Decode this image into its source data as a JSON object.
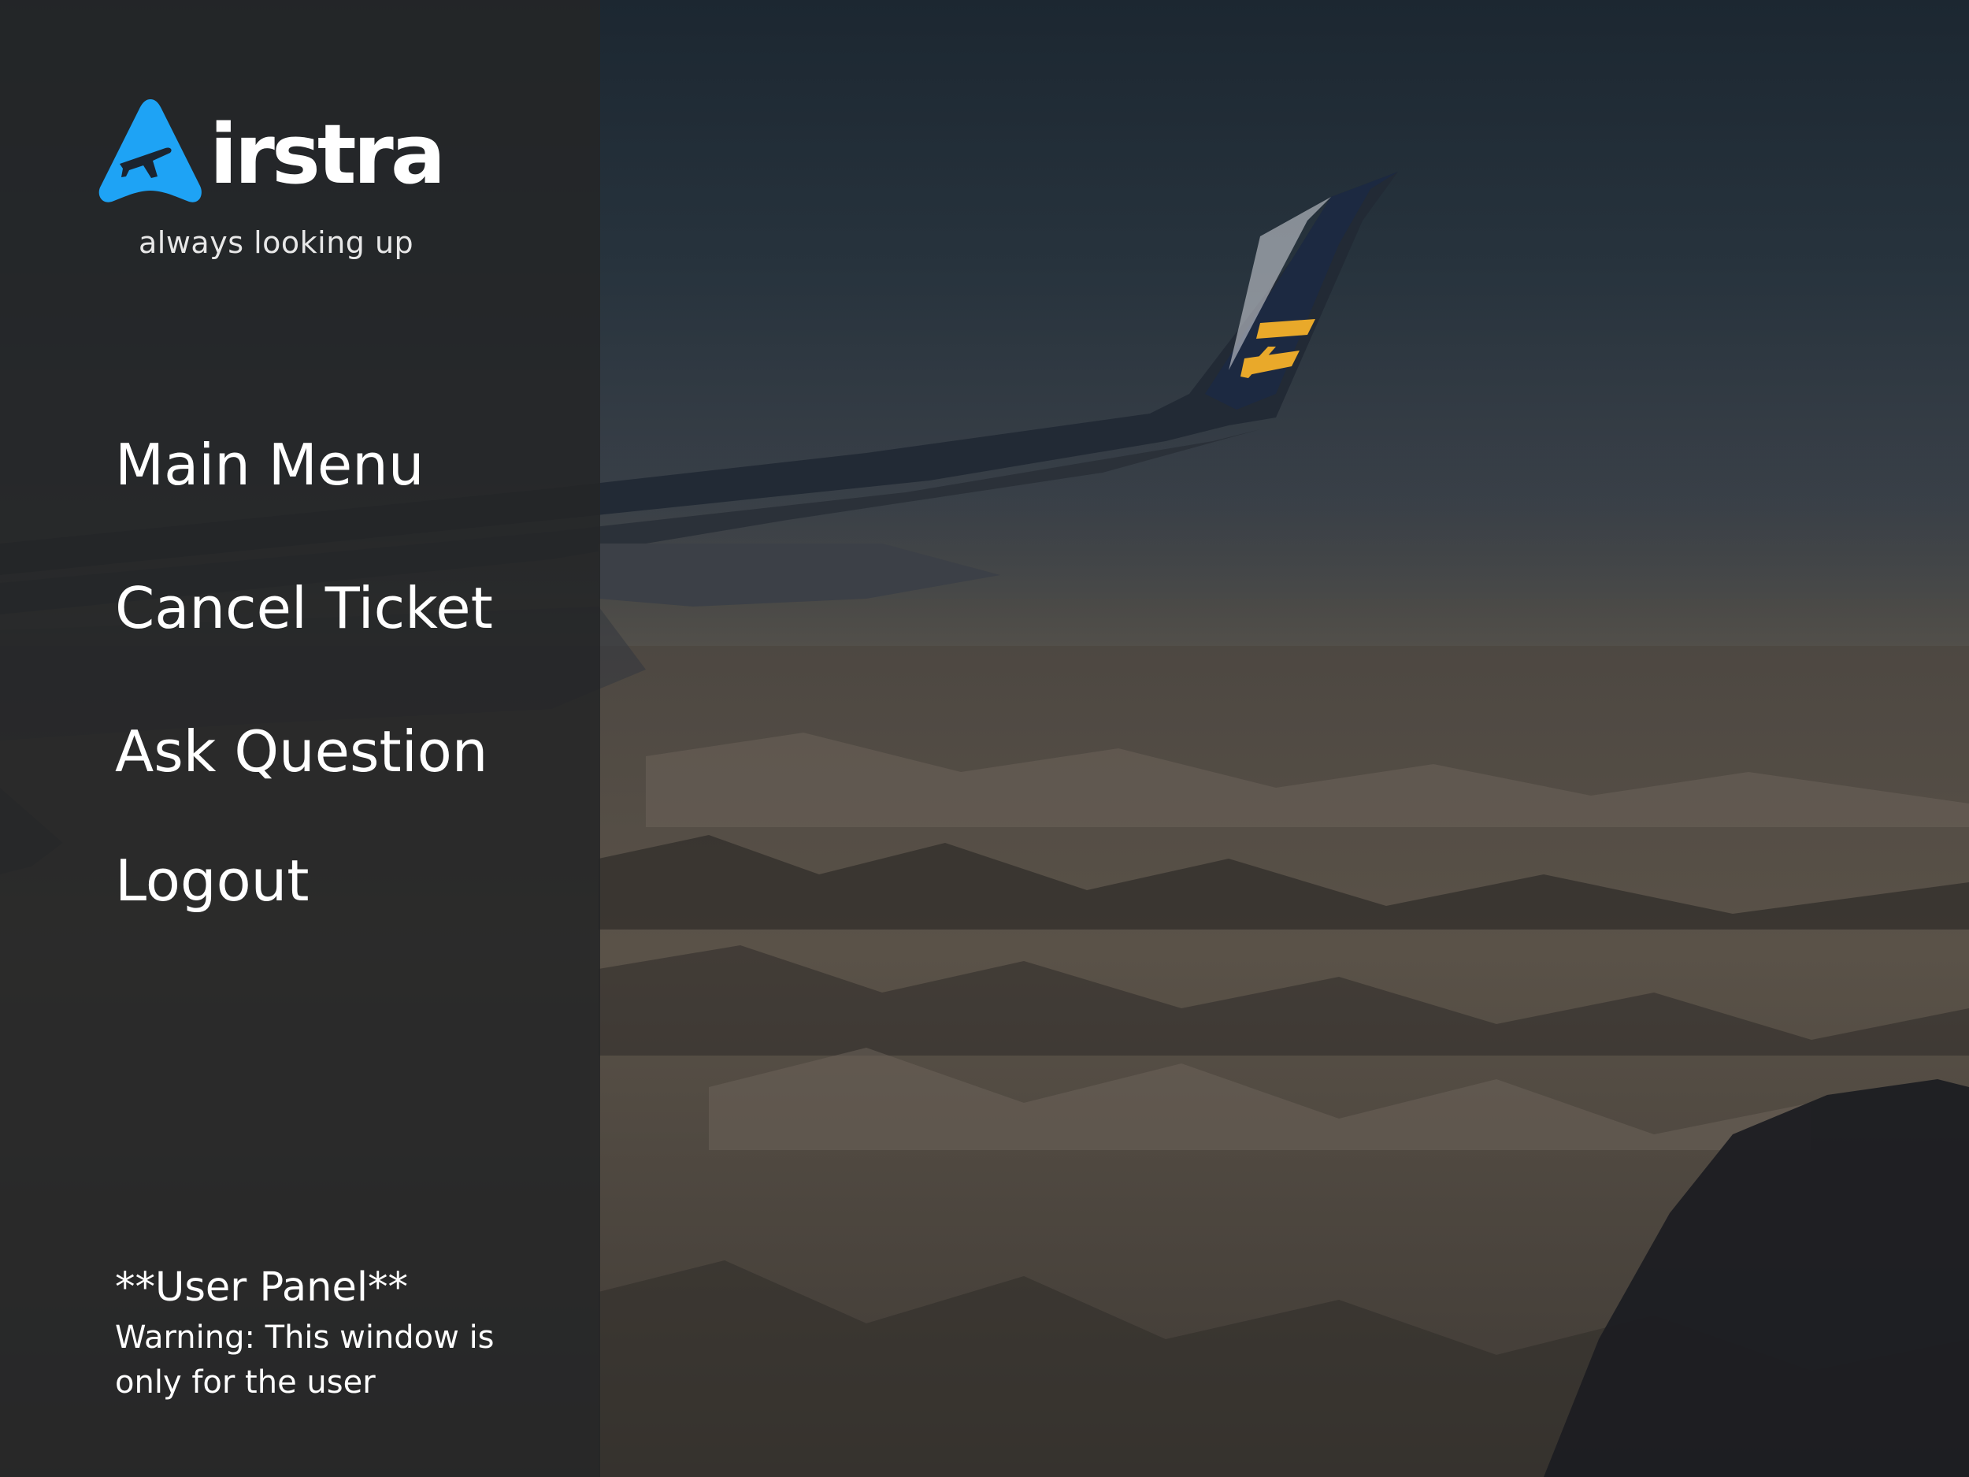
{
  "brand": {
    "wordmark": "irstra",
    "tagline": "always looking up",
    "accent_color": "#1ea3f5",
    "logo_icon": "airplane-triangle-icon"
  },
  "nav": {
    "items": [
      {
        "label": "Main Menu"
      },
      {
        "label": "Cancel Ticket"
      },
      {
        "label": "Ask Question"
      },
      {
        "label": "Logout"
      }
    ]
  },
  "user_panel": {
    "title": "**User Panel**",
    "warning": "Warning: This window is only for the user"
  },
  "colors": {
    "sidebar": "#242527",
    "winglet_logo": "#e9a92a",
    "text": "#ffffff"
  }
}
